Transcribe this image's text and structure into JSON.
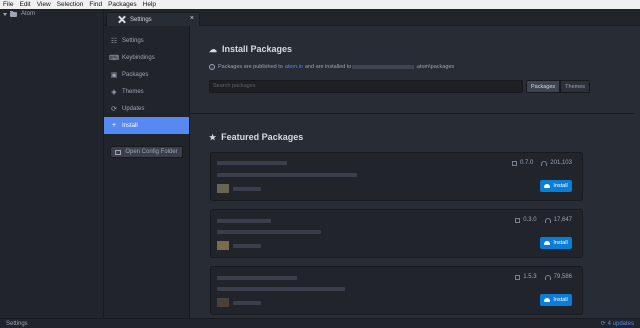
{
  "menu": [
    "File",
    "Edit",
    "View",
    "Selection",
    "Find",
    "Packages",
    "Help"
  ],
  "tree": {
    "root": "Atom"
  },
  "tab": {
    "label": "Settings",
    "close": "×"
  },
  "nav": {
    "items": [
      {
        "label": "Settings",
        "icon": "sliders-icon",
        "glyph": "☷"
      },
      {
        "label": "Keybindings",
        "icon": "keyboard-icon",
        "glyph": "⌨"
      },
      {
        "label": "Packages",
        "icon": "package-icon",
        "glyph": "▣"
      },
      {
        "label": "Themes",
        "icon": "paintcan-icon",
        "glyph": "◈"
      },
      {
        "label": "Updates",
        "icon": "sync-icon",
        "glyph": "⟳"
      },
      {
        "label": "Install",
        "icon": "plus-icon",
        "glyph": "+"
      }
    ],
    "config_button": "Open Config Folder"
  },
  "install": {
    "title": "Install Packages",
    "info_prefix": "Packages are published to",
    "info_link": "atom.io",
    "info_middle": "and are installed to",
    "info_suffix": ".atom\\packages",
    "search_placeholder": "Search packages",
    "toggle_packages": "Packages",
    "toggle_themes": "Themes"
  },
  "featured": {
    "title": "Featured Packages",
    "cards": [
      {
        "version": "0.7.0",
        "downloads": "201,103",
        "button": "Install"
      },
      {
        "version": "0.3.0",
        "downloads": "17,647",
        "button": "Install"
      },
      {
        "version": "1.5.3",
        "downloads": "79,586",
        "button": "Install"
      }
    ]
  },
  "status": {
    "left": "Settings",
    "updates": "4 updates"
  },
  "colors": {
    "accent": "#568af2",
    "install_button": "#0a7dd6",
    "panel": "#282c34",
    "sidebar": "#21252b"
  }
}
